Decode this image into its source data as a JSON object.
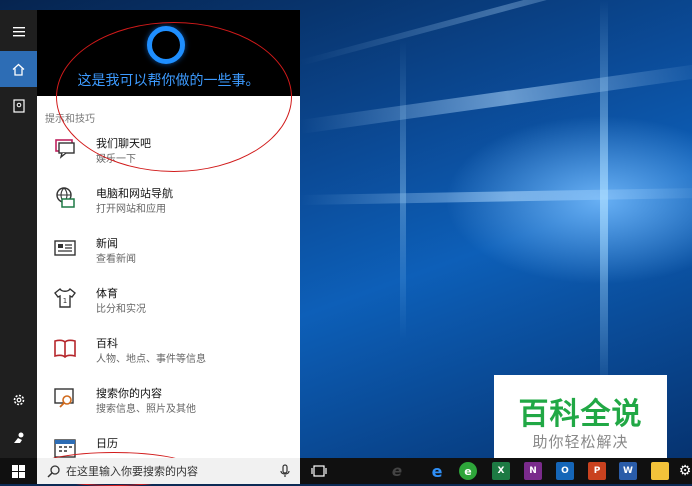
{
  "cortana": {
    "header_title": "这是我可以帮你做的一些事。",
    "section_label": "提示和技巧",
    "items": [
      {
        "title": "我们聊天吧",
        "subtitle": "娱乐一下",
        "icon": "chat-icon"
      },
      {
        "title": "电脑和网站导航",
        "subtitle": "打开网站和应用",
        "icon": "globe-monitor-icon"
      },
      {
        "title": "新闻",
        "subtitle": "查看新闻",
        "icon": "newspaper-icon"
      },
      {
        "title": "体育",
        "subtitle": "比分和实况",
        "icon": "jersey-icon"
      },
      {
        "title": "百科",
        "subtitle": "人物、地点、事件等信息",
        "icon": "book-icon"
      },
      {
        "title": "搜索你的内容",
        "subtitle": "搜索信息、照片及其他",
        "icon": "search-content-icon"
      },
      {
        "title": "日历",
        "subtitle": "",
        "icon": "calendar-icon"
      }
    ]
  },
  "rail": {
    "items": [
      "hamburger-menu-icon",
      "home-icon",
      "notebook-icon",
      "settings-icon",
      "feedback-icon"
    ]
  },
  "taskbar": {
    "search_placeholder": "在这里输入你要搜索的内容",
    "apps": [
      {
        "name": "task-view-icon",
        "label": ""
      },
      {
        "name": "ie-icon",
        "label": "e"
      },
      {
        "name": "edge-icon",
        "label": "e"
      },
      {
        "name": "browser-360-icon",
        "label": "e"
      },
      {
        "name": "excel-icon",
        "label": "X"
      },
      {
        "name": "onenote-icon",
        "label": "N"
      },
      {
        "name": "outlook-icon",
        "label": "O"
      },
      {
        "name": "powerpoint-icon",
        "label": "P"
      },
      {
        "name": "word-icon",
        "label": "W"
      },
      {
        "name": "sticky-notes-icon",
        "label": ""
      },
      {
        "name": "gear-icon",
        "label": "⚙"
      }
    ]
  },
  "watermark": {
    "title": "百科全说",
    "subtitle": "助你轻松解决"
  },
  "colors": {
    "accent": "#2d6db5",
    "cortana_text": "#3d9bff",
    "annotation": "#d11a1a",
    "watermark_green": "#21a845"
  }
}
